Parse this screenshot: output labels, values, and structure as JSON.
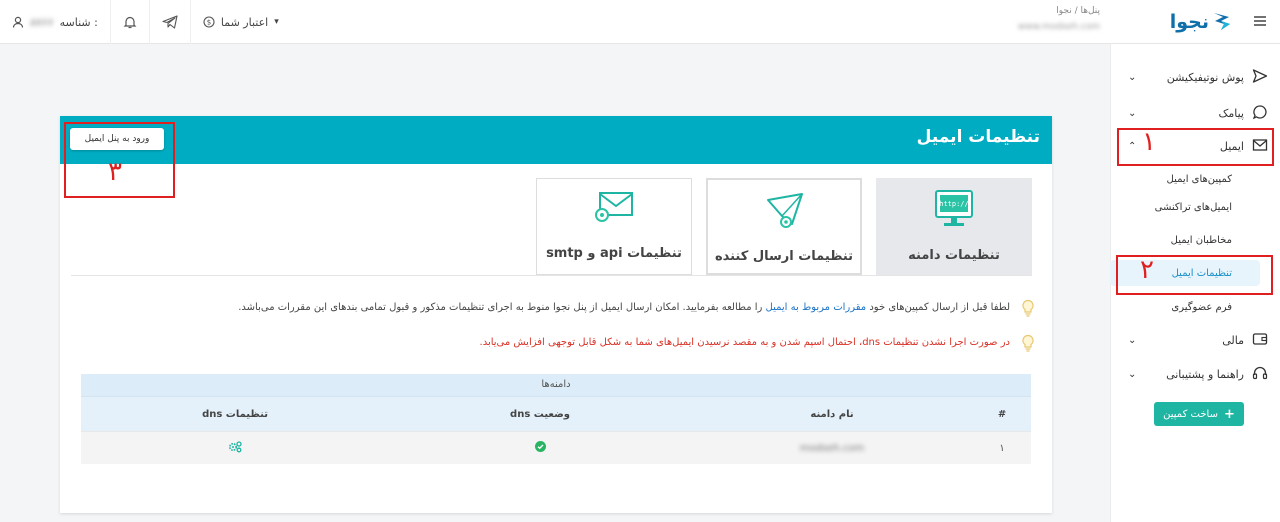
{
  "topbar": {
    "profile_label": "شناسه :",
    "profile_value": "۸۷۶۶",
    "credit_label": "اعتبار شما",
    "breadcrumb": "پنل‌ها / نجوا",
    "domain_blurred": "www.modseh.com",
    "logo_text": "نجوا"
  },
  "sidebar": {
    "items": [
      {
        "label": "پوش نوتیفیکیشن",
        "icon": "send-icon"
      },
      {
        "label": "پیامک",
        "icon": "chat-icon"
      },
      {
        "label": "ایمیل",
        "icon": "mail-icon"
      },
      {
        "label": "مالی",
        "icon": "wallet-icon"
      },
      {
        "label": "راهنما و پشتیبانی",
        "icon": "headset-icon"
      }
    ],
    "sub_items": [
      {
        "label": "کمپین‌های ایمیل"
      },
      {
        "label": "ایمیل‌های تراکنشی"
      },
      {
        "label": "مخاطبان ایمیل"
      },
      {
        "label": "تنظیمات ایمیل"
      },
      {
        "label": "فرم عضوگیری"
      }
    ],
    "build_button": "ساخت کمپین"
  },
  "card": {
    "title": "تنظیمات ایمیل",
    "login_button": "ورود به پنل ایمیل",
    "tabs": [
      {
        "label": "تنظیمات دامنه",
        "icon": "browser-http-icon"
      },
      {
        "label": "تنظیمات ارسال کننده",
        "icon": "paper-plane-gear-icon"
      },
      {
        "label": "تنظیمات api و smtp",
        "icon": "envelope-gear-icon"
      }
    ],
    "note1_a": "لطفا قبل از ارسال کمپین‌های خود ",
    "note1_link": "مقررات مربوط به ایمیل",
    "note1_b": " را مطالعه بفرمایید. امکان ارسال ایمیل از پنل نجوا منوط به اجرای تنظیمات مذکور و قبول تمامی بندهای این مقررات می‌باشد.",
    "note2": "در صورت اجرا نشدن تنظیمات dns، احتمال اسپم شدن و به مقصد نرسیدن ایمیل‌های شما به شکل قابل توجهی افزایش می‌یابد."
  },
  "table": {
    "caption": "دامنه‌ها",
    "headers": [
      "#",
      "نام دامنه",
      "وضعیت dns",
      "تنظیمات dns"
    ],
    "rows": [
      {
        "index": "۱",
        "domain": "modseh.com"
      }
    ]
  },
  "annotations": [
    "۱",
    "۲",
    "۳"
  ],
  "colors": {
    "header": "#00acc1",
    "accent": "#1fb5a3",
    "annotation": "#e02020",
    "link": "#1a73c8"
  }
}
